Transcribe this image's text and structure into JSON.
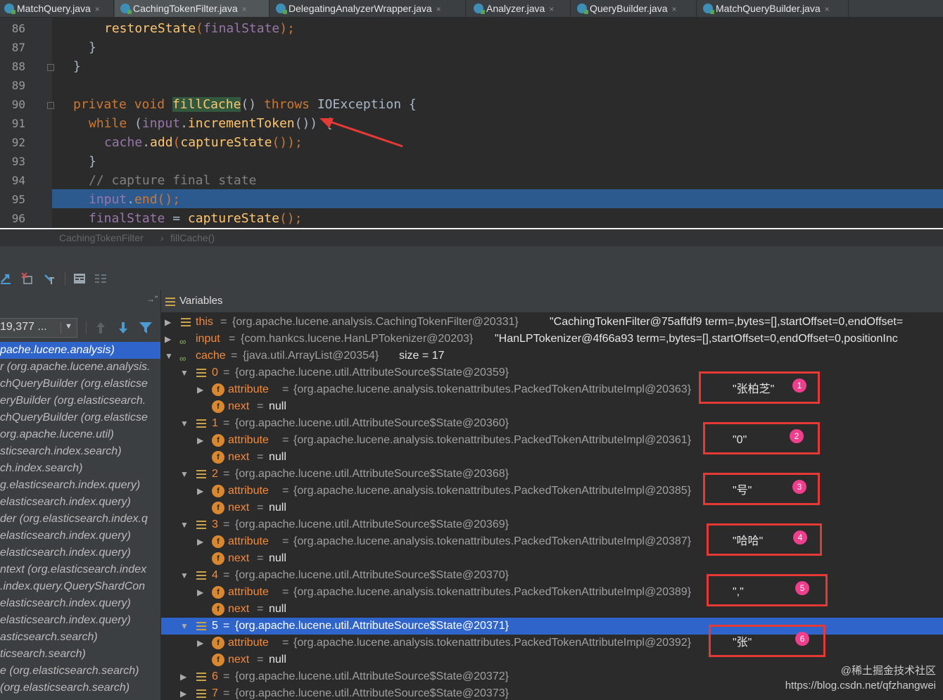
{
  "tabs": [
    {
      "label": "MatchQuery.java"
    },
    {
      "label": "CachingTokenFilter.java"
    },
    {
      "label": "DelegatingAnalyzerWrapper.java"
    },
    {
      "label": "Analyzer.java"
    },
    {
      "label": "QueryBuilder.java"
    },
    {
      "label": "MatchQueryBuilder.java"
    }
  ],
  "tab_close": "×",
  "editor": {
    "line_numbers": [
      "86",
      "87",
      "88",
      "89",
      "90",
      "91",
      "92",
      "93",
      "94",
      "95",
      "96"
    ],
    "l86_fn": "restoreState",
    "l86_rest": "(",
    "l86_fld": "finalState",
    "l86_end": ");",
    "brace": "}",
    "l90_kw": "private void",
    "l90_fn": "fillCache",
    "l90_parens": "()",
    "l90_throws": "throws",
    "l90_type": "IOException {",
    "l91_kw": "while",
    "l91_open": "(",
    "l91_fld": "input",
    "l91_dot": ".",
    "l91_fn": "incrementToken",
    "l91_close": "()) {",
    "l92_fld": "cache",
    "l92_dot": ".",
    "l92_fn": "add",
    "l92_open": "(",
    "l92_fn2": "captureState",
    "l92_close": "());",
    "l94_comment": "// capture final state",
    "l95_fld": "input",
    "l95_dot": ".",
    "l95_fn": "end",
    "l95_close": "();",
    "l96_fld": "finalState",
    "l96_eq": "=",
    "l96_fn": "captureState",
    "l96_close": "();"
  },
  "breadcrumb": {
    "class": "CachingTokenFilter",
    "sep": "›",
    "method": "fillCache()"
  },
  "frames": {
    "thread_value": "19,377 ...",
    "items": [
      {
        "text": "pache.lucene.analysis)"
      },
      {
        "text": "r (org.apache.lucene.analysis."
      },
      {
        "text": "chQueryBuilder (org.elasticse"
      },
      {
        "text": "eryBuilder (org.elasticsearch."
      },
      {
        "text": "chQueryBuilder (org.elasticse"
      },
      {
        "text": "org.apache.lucene.util)"
      },
      {
        "text": "sticsearch.index.search)"
      },
      {
        "text": "ch.index.search)"
      },
      {
        "text": "g.elasticsearch.index.query)"
      },
      {
        "text": "elasticsearch.index.query)"
      },
      {
        "text": "der (org.elasticsearch.index.q"
      },
      {
        "text": "elasticsearch.index.query)"
      },
      {
        "text": "elasticsearch.index.query)"
      },
      {
        "text": "ntext (org.elasticsearch.index"
      },
      {
        "text": ".index.query.QueryShardCon"
      },
      {
        "text": "elasticsearch.index.query)"
      },
      {
        "text": "elasticsearch.index.query)"
      },
      {
        "text": "asticsearch.search)"
      },
      {
        "text": "ticsearch.search)"
      },
      {
        "text": "e (org.elasticsearch.search)"
      },
      {
        "text": "(org.elasticsearch.search)"
      }
    ]
  },
  "variables": {
    "header": "Variables",
    "eq": "=",
    "this_name": "this",
    "this_val": "{org.apache.lucene.analysis.CachingTokenFilter@20331}",
    "this_text": "\"CachingTokenFilter@75affdf9 term=,bytes=[],startOffset=0,endOffset=",
    "input_name": "input",
    "input_val": "{com.hankcs.lucene.HanLPTokenizer@20203}",
    "input_text": "\"HanLPTokenizer@4f66a93 term=,bytes=[],startOffset=0,endOffset=0,positionInc",
    "cache_name": "cache",
    "cache_val": "{java.util.ArrayList@20354}",
    "cache_size": "size = 17",
    "attr_name": "attribute",
    "next_name": "next",
    "null": "null",
    "items": [
      {
        "idx": "0",
        "state": "{org.apache.lucene.util.AttributeSource$State@20359}",
        "attr": "{org.apache.lucene.analysis.tokenattributes.PackedTokenAttributeImpl@20363}",
        "term": "\"张柏芝\"",
        "badge": "1"
      },
      {
        "idx": "1",
        "state": "{org.apache.lucene.util.AttributeSource$State@20360}",
        "attr": "{org.apache.lucene.analysis.tokenattributes.PackedTokenAttributeImpl@20361}",
        "term": "\"0\"",
        "badge": "2"
      },
      {
        "idx": "2",
        "state": "{org.apache.lucene.util.AttributeSource$State@20368}",
        "attr": "{org.apache.lucene.analysis.tokenattributes.PackedTokenAttributeImpl@20385}",
        "term": "\"号\"",
        "badge": "3"
      },
      {
        "idx": "3",
        "state": "{org.apache.lucene.util.AttributeSource$State@20369}",
        "attr": "{org.apache.lucene.analysis.tokenattributes.PackedTokenAttributeImpl@20387}",
        "term": "\"哈哈\"",
        "badge": "4"
      },
      {
        "idx": "4",
        "state": "{org.apache.lucene.util.AttributeSource$State@20370}",
        "attr": "{org.apache.lucene.analysis.tokenattributes.PackedTokenAttributeImpl@20389}",
        "term": "\",\"",
        "badge": "5"
      },
      {
        "idx": "5",
        "state": "{org.apache.lucene.util.AttributeSource$State@20371}",
        "attr": "{org.apache.lucene.analysis.tokenattributes.PackedTokenAttributeImpl@20392}",
        "term": "\"张\"",
        "badge": "6"
      }
    ],
    "collapsed": [
      {
        "idx": "6",
        "state": "{org.apache.lucene.util.AttributeSource$State@20372}"
      },
      {
        "idx": "7",
        "state": "{org.apache.lucene.util.AttributeSource$State@20373}"
      }
    ]
  },
  "watermark": {
    "line1": "@稀土掘金技术社区",
    "line2": "https://blog.csdn.net/qfzhangwei"
  },
  "colors": {
    "accent": "#2f65ca",
    "annotation_red": "#e53935",
    "badge_pink": "#ef3e8c",
    "keyword": "#cc7832",
    "method": "#ffc66d",
    "field": "#9876aa"
  }
}
